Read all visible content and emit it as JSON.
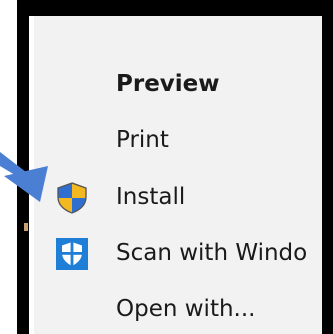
{
  "menu": {
    "items": [
      {
        "label": "Preview",
        "bold": true,
        "icon": null
      },
      {
        "label": "Print",
        "bold": false,
        "icon": null
      },
      {
        "label": "Install",
        "bold": false,
        "icon": "uac-shield-icon"
      },
      {
        "label": "Scan with Windo",
        "bold": false,
        "icon": "windows-defender-icon"
      },
      {
        "label": "Open with...",
        "bold": false,
        "icon": null
      }
    ]
  },
  "colors": {
    "frame": "#000000",
    "menu_bg": "#f2f2f2",
    "arrow": "#4a7fd4",
    "uac_blue": "#2f6fcf",
    "uac_yellow": "#f3b71f",
    "defender_blue": "#1f7fd6"
  }
}
